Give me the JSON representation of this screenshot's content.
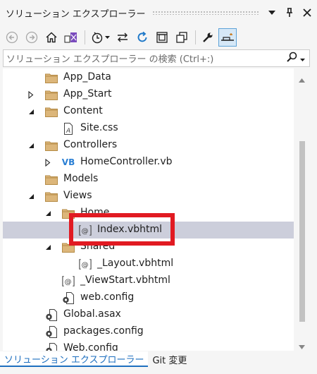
{
  "window": {
    "title": "ソリューション エクスプローラー"
  },
  "search": {
    "placeholder": "ソリューション エクスプローラー の検索 (Ctrl+:)"
  },
  "tree": [
    {
      "label": "App_Data",
      "icon": "folder-icon",
      "expander": "none",
      "depth": 1
    },
    {
      "label": "App_Start",
      "icon": "folder-icon",
      "expander": "collapsed",
      "depth": 1
    },
    {
      "label": "Content",
      "icon": "folder-icon",
      "expander": "expanded",
      "depth": 1
    },
    {
      "label": "Site.css",
      "icon": "css-file-icon",
      "expander": "none",
      "depth": 2
    },
    {
      "label": "Controllers",
      "icon": "folder-icon",
      "expander": "expanded",
      "depth": 1
    },
    {
      "label": "HomeController.vb",
      "icon": "vb-file-icon",
      "expander": "collapsed",
      "depth": 2
    },
    {
      "label": "Models",
      "icon": "folder-icon",
      "expander": "none",
      "depth": 1
    },
    {
      "label": "Views",
      "icon": "folder-icon",
      "expander": "expanded",
      "depth": 1
    },
    {
      "label": "Home",
      "icon": "folder-icon",
      "expander": "expanded",
      "depth": 2
    },
    {
      "label": "Index.vbhtml",
      "icon": "razor-file-icon",
      "expander": "none",
      "depth": 3,
      "selected": true
    },
    {
      "label": "Shared",
      "icon": "folder-icon",
      "expander": "expanded",
      "depth": 2
    },
    {
      "label": "_Layout.vbhtml",
      "icon": "razor-file-icon",
      "expander": "none",
      "depth": 3
    },
    {
      "label": "_ViewStart.vbhtml",
      "icon": "razor-file-icon",
      "expander": "none",
      "depth": 2
    },
    {
      "label": "web.config",
      "icon": "config-file-icon",
      "expander": "none",
      "depth": 2
    },
    {
      "label": "Global.asax",
      "icon": "config-file-icon",
      "expander": "none",
      "depth": 1
    },
    {
      "label": "packages.config",
      "icon": "config-file-icon",
      "expander": "none",
      "depth": 1
    },
    {
      "label": "Web.config",
      "icon": "config-file-icon",
      "expander": "none",
      "depth": 1
    }
  ],
  "tabs": [
    {
      "label": "ソリューション エクスプローラー",
      "active": true
    },
    {
      "label": "Git 変更",
      "active": false
    }
  ],
  "colors": {
    "accent": "#1e6fbf",
    "selection": "#cccedb",
    "highlight": "#e11a22",
    "folder": "#dcb67a"
  }
}
